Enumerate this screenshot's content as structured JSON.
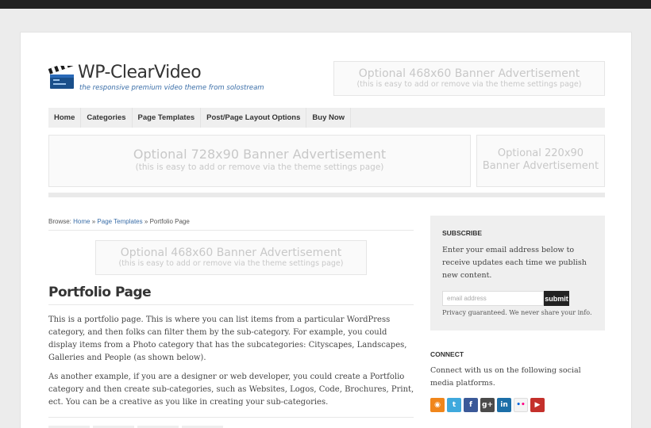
{
  "site": {
    "title": "WP-ClearVideo",
    "tagline": "the responsive premium video theme from solostream"
  },
  "ads": {
    "top": {
      "line1": "Optional 468x60 Banner Advertisement",
      "line2": "(this is easy to add or remove via the theme settings page)"
    },
    "wide": {
      "line1": "Optional 728x90 Banner Advertisement",
      "line2": "(this is easy to add or remove via the theme settings page)"
    },
    "side": {
      "line1": "Optional 220x90",
      "line2": "Banner Advertisement"
    },
    "content": {
      "line1": "Optional 468x60 Banner Advertisement",
      "line2": "(this is easy to add or remove via the theme settings page)"
    }
  },
  "nav": {
    "items": [
      {
        "label": "Home"
      },
      {
        "label": "Categories"
      },
      {
        "label": "Page Templates"
      },
      {
        "label": "Post/Page Layout Options"
      },
      {
        "label": "Buy Now"
      }
    ]
  },
  "breadcrumb": {
    "prefix": "Browse:",
    "home": "Home",
    "sep1": "»",
    "section": "Page Templates",
    "sep2": "»",
    "current": "Portfolio Page"
  },
  "main": {
    "title": "Portfolio Page",
    "paragraph1": "This is a portfolio page. This is where you can list items from a particular WordPress category, and then folks can filter them by the sub-category. For example, you could display items from a Photo category that has the subcategories: Cityscapes, Landscapes, Galleries and People (as shown below).",
    "paragraph2": "As another example, if you are a designer or web developer, you could create a Portfolio category and then create sub-categories, such as Websites, Logos, Code, Brochures, Print, ect. You can be a creative as you like in creating your sub-categories."
  },
  "sidebar": {
    "subscribe": {
      "title": "SUBSCRIBE",
      "text": "Enter your email address below to receive updates each time we publish new content.",
      "placeholder": "email address",
      "button": "submit",
      "privacy": "Privacy guaranteed. We never share your info."
    },
    "connect": {
      "title": "CONNECT",
      "text": "Connect with us on the following social media platforms."
    },
    "social": [
      {
        "name": "rss-icon",
        "glyph": "◉",
        "color": "#f0861b"
      },
      {
        "name": "twitter-icon",
        "glyph": "t",
        "color": "#3fa9dd"
      },
      {
        "name": "facebook-icon",
        "glyph": "f",
        "color": "#3b5998"
      },
      {
        "name": "google-plus-icon",
        "glyph": "g+",
        "color": "#4a4a4a"
      },
      {
        "name": "linkedin-icon",
        "glyph": "in",
        "color": "#1c6fa8"
      },
      {
        "name": "flickr-icon",
        "glyph": "••",
        "color": "#f4f4f4"
      },
      {
        "name": "youtube-icon",
        "glyph": "▶",
        "color": "#c4302b"
      }
    ]
  }
}
